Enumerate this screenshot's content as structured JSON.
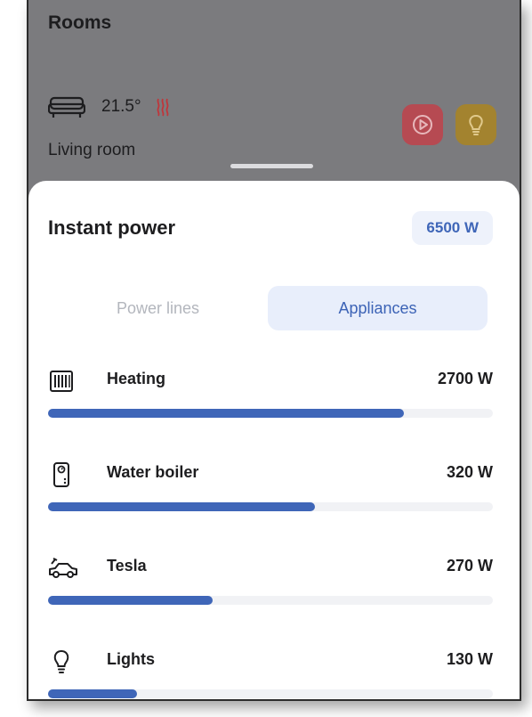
{
  "header": {
    "title": "Rooms"
  },
  "room": {
    "temperature": "21.5°",
    "name": "Living room",
    "icons": [
      "sofa-icon",
      "heating-icon",
      "play-icon",
      "lightbulb-icon"
    ],
    "play_button_color": "#b64a52",
    "light_button_color": "#a3832f"
  },
  "sheet": {
    "title": "Instant power",
    "total_power": "6500 W",
    "tabs": [
      {
        "label": "Power lines",
        "active": false
      },
      {
        "label": "Appliances",
        "active": true
      }
    ],
    "appliances": [
      {
        "name": "Heating",
        "value": "2700 W",
        "icon": "radiator-icon",
        "level": 0.8
      },
      {
        "name": "Water boiler",
        "value": "320 W",
        "icon": "water-boiler-icon",
        "level": 0.6
      },
      {
        "name": "Tesla",
        "value": "270 W",
        "icon": "electric-car-icon",
        "level": 0.37
      },
      {
        "name": "Lights",
        "value": "130 W",
        "icon": "lightbulb-icon",
        "level": 0.2
      }
    ]
  },
  "colors": {
    "accent": "#3f66b8",
    "accent_bg": "#e8eefb",
    "overlay_bg": "#7b7b7e"
  }
}
